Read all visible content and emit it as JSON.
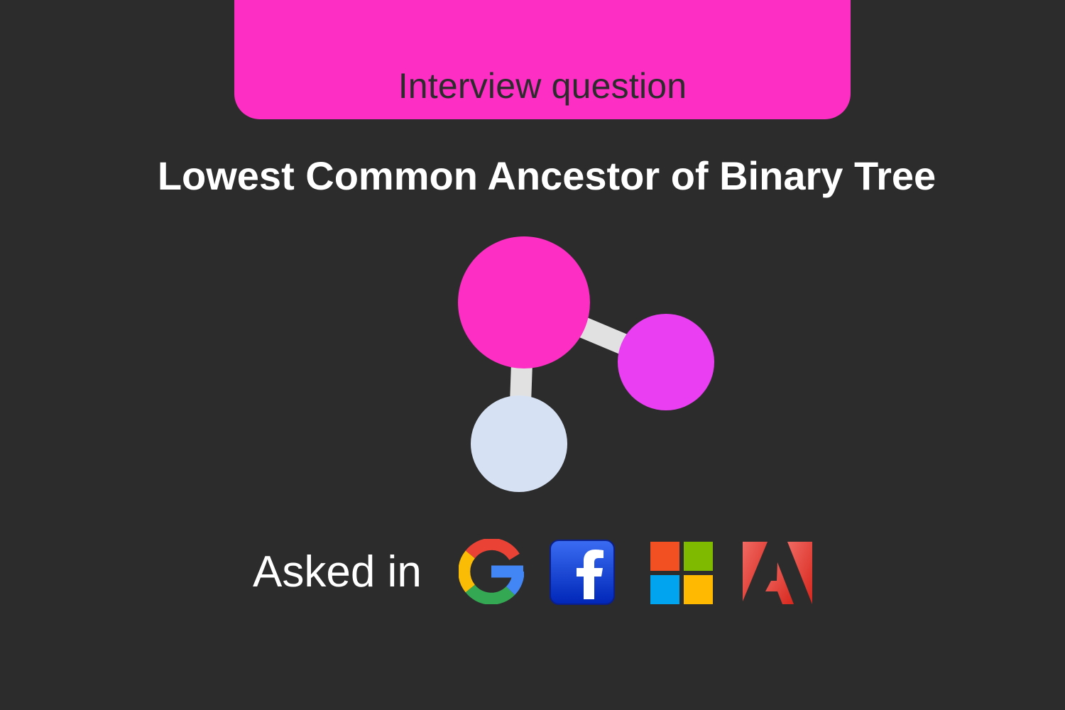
{
  "banner": {
    "label": "Interview question",
    "color": "#fd2ec4"
  },
  "title": "Lowest Common Ancestor of Binary Tree",
  "illustration": {
    "nodes": [
      {
        "role": "root",
        "color": "#fd2ec4"
      },
      {
        "role": "right-child",
        "color": "#e93ef2"
      },
      {
        "role": "left-child",
        "color": "#d6e2f4"
      }
    ],
    "edge_color": "#e1e1e1"
  },
  "asked_in": {
    "label": "Asked in",
    "companies": [
      {
        "name": "Google",
        "icon": "google-logo-icon"
      },
      {
        "name": "Facebook",
        "icon": "facebook-logo-icon"
      },
      {
        "name": "Microsoft",
        "icon": "microsoft-logo-icon"
      },
      {
        "name": "Adobe",
        "icon": "adobe-logo-icon"
      }
    ]
  },
  "colors": {
    "background": "#2c2c2c",
    "text": "#ffffff"
  }
}
